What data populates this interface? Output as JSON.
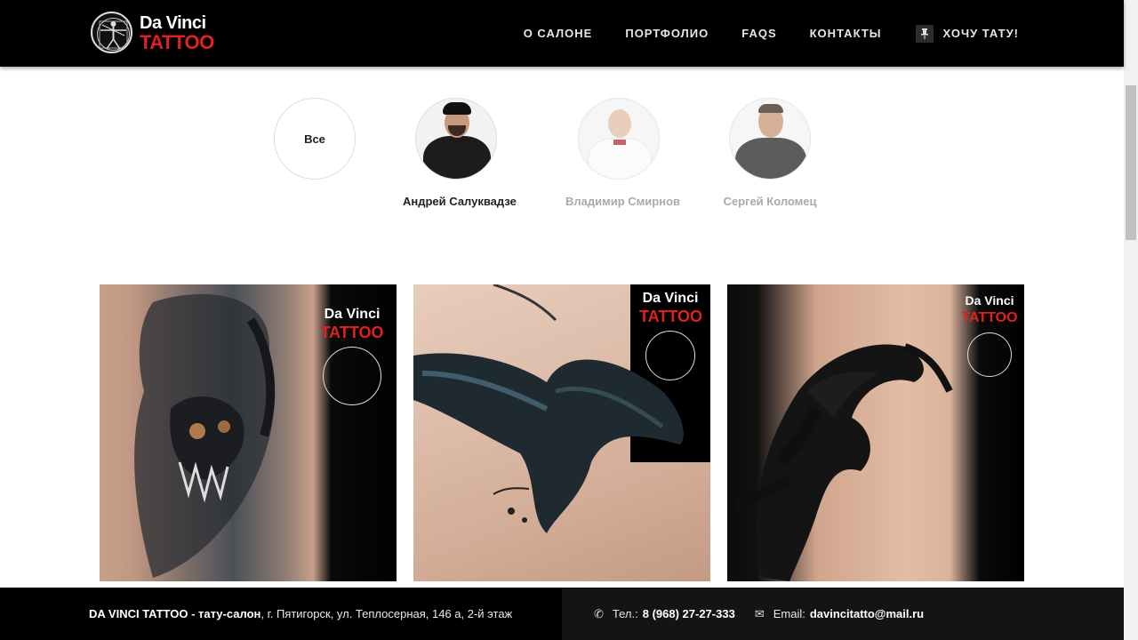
{
  "header": {
    "logo": {
      "line1": "Da Vinci",
      "line2": "TATTOO"
    },
    "nav": [
      {
        "label": "О САЛОНЕ"
      },
      {
        "label": "ПОРТФОЛИО"
      },
      {
        "label": "FAQS"
      },
      {
        "label": "КОНТАКТЫ"
      },
      {
        "label": "ХОЧУ ТАТУ!",
        "icon": "pushpin-icon"
      }
    ]
  },
  "filters": {
    "all_label": "Все",
    "artists": [
      {
        "name": "Андрей Салуквадзе",
        "active": true
      },
      {
        "name": "Владимир Смирнов",
        "active": false
      },
      {
        "name": "Сергей Коломец",
        "active": false
      }
    ]
  },
  "gallery": {
    "tiles": [
      {
        "subject": "demon-skull-tattoo",
        "logo_line1": "Da Vinci",
        "logo_line2": "TATTOO"
      },
      {
        "subject": "raven-tattoo",
        "logo_line1": "Da Vinci",
        "logo_line2": "TATTOO"
      },
      {
        "subject": "tribal-tattoo",
        "logo_line1": "Da Vinci",
        "logo_line2": "TATTOO"
      }
    ]
  },
  "footer": {
    "salon_name": "DA VINCI TATTOO - тату-салон",
    "address": ", г. Пятигорск, ул. Теплосерная, 146 а, 2-й этаж",
    "phone_label": "Тел.:",
    "phone": "8 (968) 27-27-333",
    "email_label": "Email:",
    "email": "davincitatto@mail.ru"
  },
  "colors": {
    "accent": "#e0211f",
    "header_bg": "#000000",
    "footer_bg": "#000000"
  }
}
